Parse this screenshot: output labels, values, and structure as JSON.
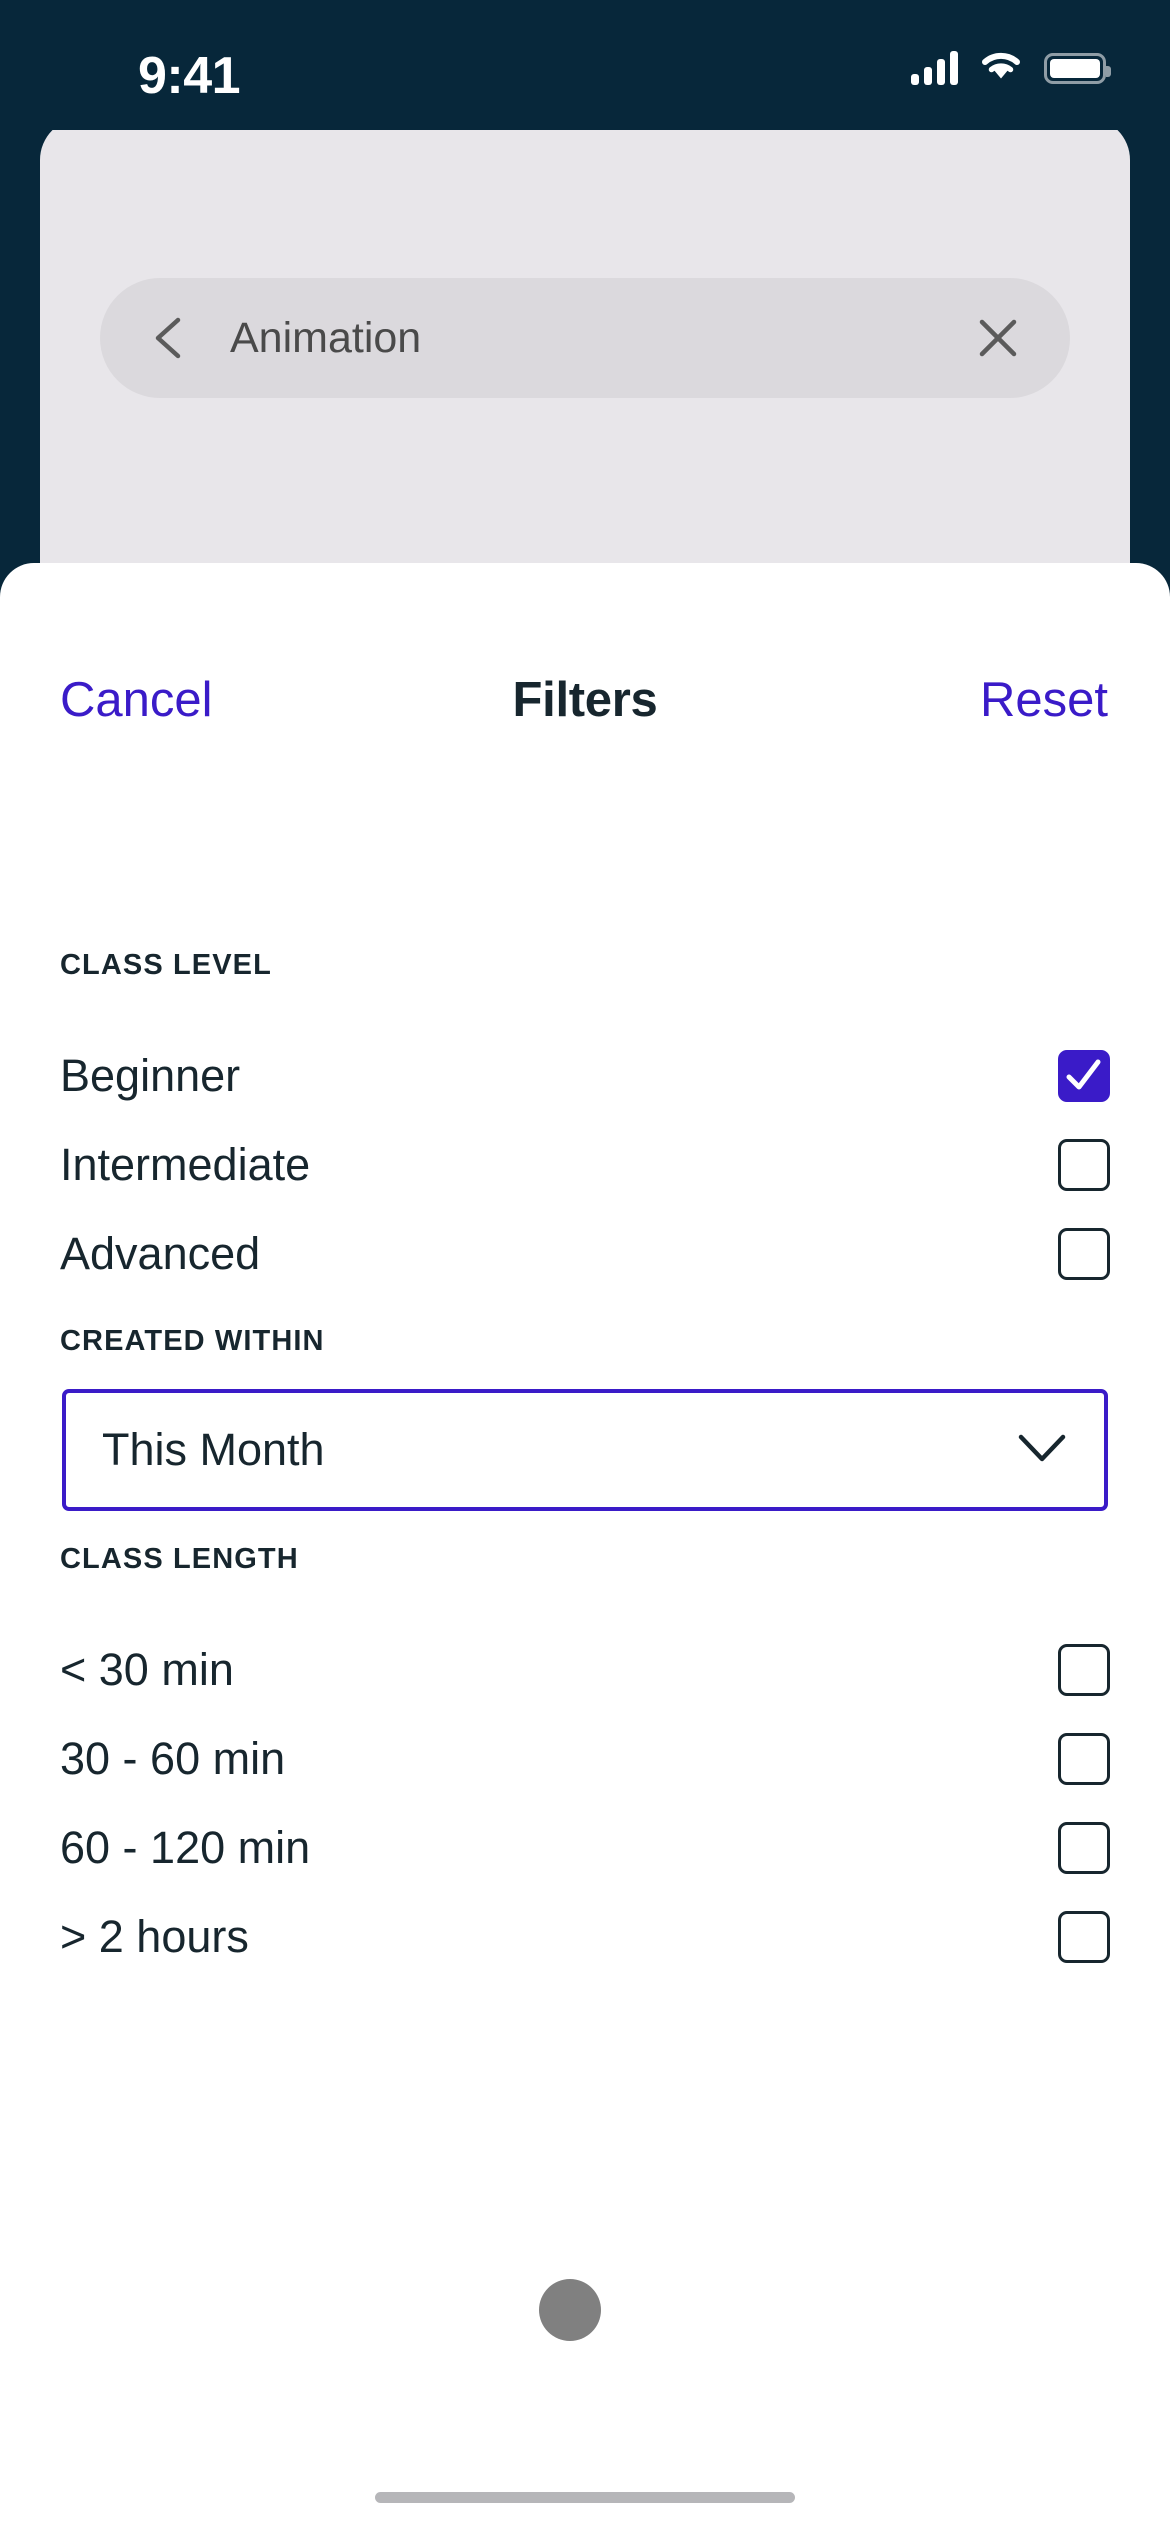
{
  "status_bar": {
    "time": "9:41",
    "icons": [
      "cellular-signal-icon",
      "wifi-icon",
      "battery-icon"
    ],
    "background_color": "#07273A"
  },
  "search": {
    "back_icon": "chevron-left-icon",
    "query": "Animation",
    "clear_icon": "close-icon",
    "pill_color": "#DBD9DD"
  },
  "sheet": {
    "cancel_label": "Cancel",
    "title": "Filters",
    "reset_label": "Reset",
    "accent_color": "#3A1BC8",
    "text_color": "#17262E"
  },
  "sections": {
    "class_level": {
      "heading": "CLASS LEVEL",
      "options": [
        {
          "label": "Beginner",
          "checked": true
        },
        {
          "label": "Intermediate",
          "checked": false
        },
        {
          "label": "Advanced",
          "checked": false
        }
      ]
    },
    "created_within": {
      "heading": "CREATED WITHIN",
      "selected": "This Month",
      "chevron_icon": "chevron-down-icon"
    },
    "class_length": {
      "heading": "CLASS LENGTH",
      "options": [
        {
          "label": "< 30 min",
          "checked": false
        },
        {
          "label": "30 - 60 min",
          "checked": false
        },
        {
          "label": "60 - 120 min",
          "checked": false
        },
        {
          "label": "> 2 hours",
          "checked": false
        }
      ]
    }
  },
  "overlays": {
    "touch_indicator_color": "#808080",
    "home_indicator_color": "#B6B6B9"
  }
}
